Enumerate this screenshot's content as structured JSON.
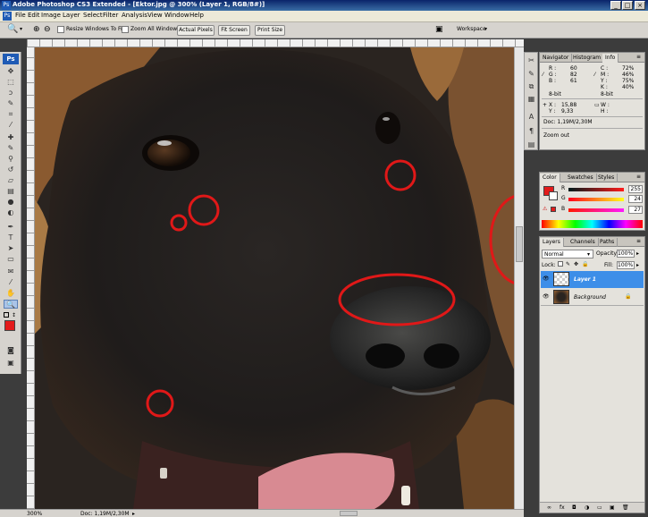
{
  "window": {
    "title": "Adobe Photoshop CS3 Extended - [Ektor.jpg @ 300% (Layer 1, RGB/8#)]"
  },
  "menu": [
    "File",
    "Edit",
    "Image",
    "Layer",
    "Select",
    "Filter",
    "Analysis",
    "View",
    "Window",
    "Help"
  ],
  "options": {
    "resize_label": "Resize Windows To Fit",
    "zoom_all_label": "Zoom All Windows",
    "actual_pixels": "Actual Pixels",
    "fit_screen": "Fit Screen",
    "print_size": "Print Size",
    "workspace": "Workspace"
  },
  "toolbox": {
    "logo": "Ps"
  },
  "status": {
    "zoom": "300%",
    "doc": "Doc: 1,19M/2,30M"
  },
  "info_panel": {
    "tabs": [
      "Navigator",
      "Histogram",
      "Info"
    ],
    "r_label": "R :",
    "r": "60",
    "g_label": "G :",
    "g": "82",
    "b_label": "B :",
    "b": "61",
    "c_label": "C :",
    "c": "72%",
    "m_label": "M :",
    "m": "46%",
    "y_label": "Y :",
    "y": "75%",
    "k_label": "K :",
    "k": "40%",
    "bit_left": "8-bit",
    "bit_right": "8-bit",
    "x_label": "X :",
    "x": "15,88",
    "y2_label": "Y :",
    "y2": "9,33",
    "w_label": "W :",
    "h_label": "H :",
    "doc": "Doc: 1,19M/2,30M",
    "hint": "Zoom out"
  },
  "color_panel": {
    "tabs": [
      "Color",
      "Swatches",
      "Styles"
    ],
    "r_label": "R",
    "r": "255",
    "g_label": "G",
    "g": "24",
    "b_label": "B",
    "b": "27",
    "fg_color": "#e31b1b"
  },
  "layers_panel": {
    "tabs": [
      "Layers",
      "Channels",
      "Paths"
    ],
    "blend_mode": "Normal",
    "opacity_label": "Opacity:",
    "opacity": "100%",
    "lock_label": "Lock:",
    "fill_label": "Fill:",
    "fill": "100%",
    "layers": [
      {
        "name": "Layer 1"
      },
      {
        "name": "Background"
      }
    ]
  }
}
